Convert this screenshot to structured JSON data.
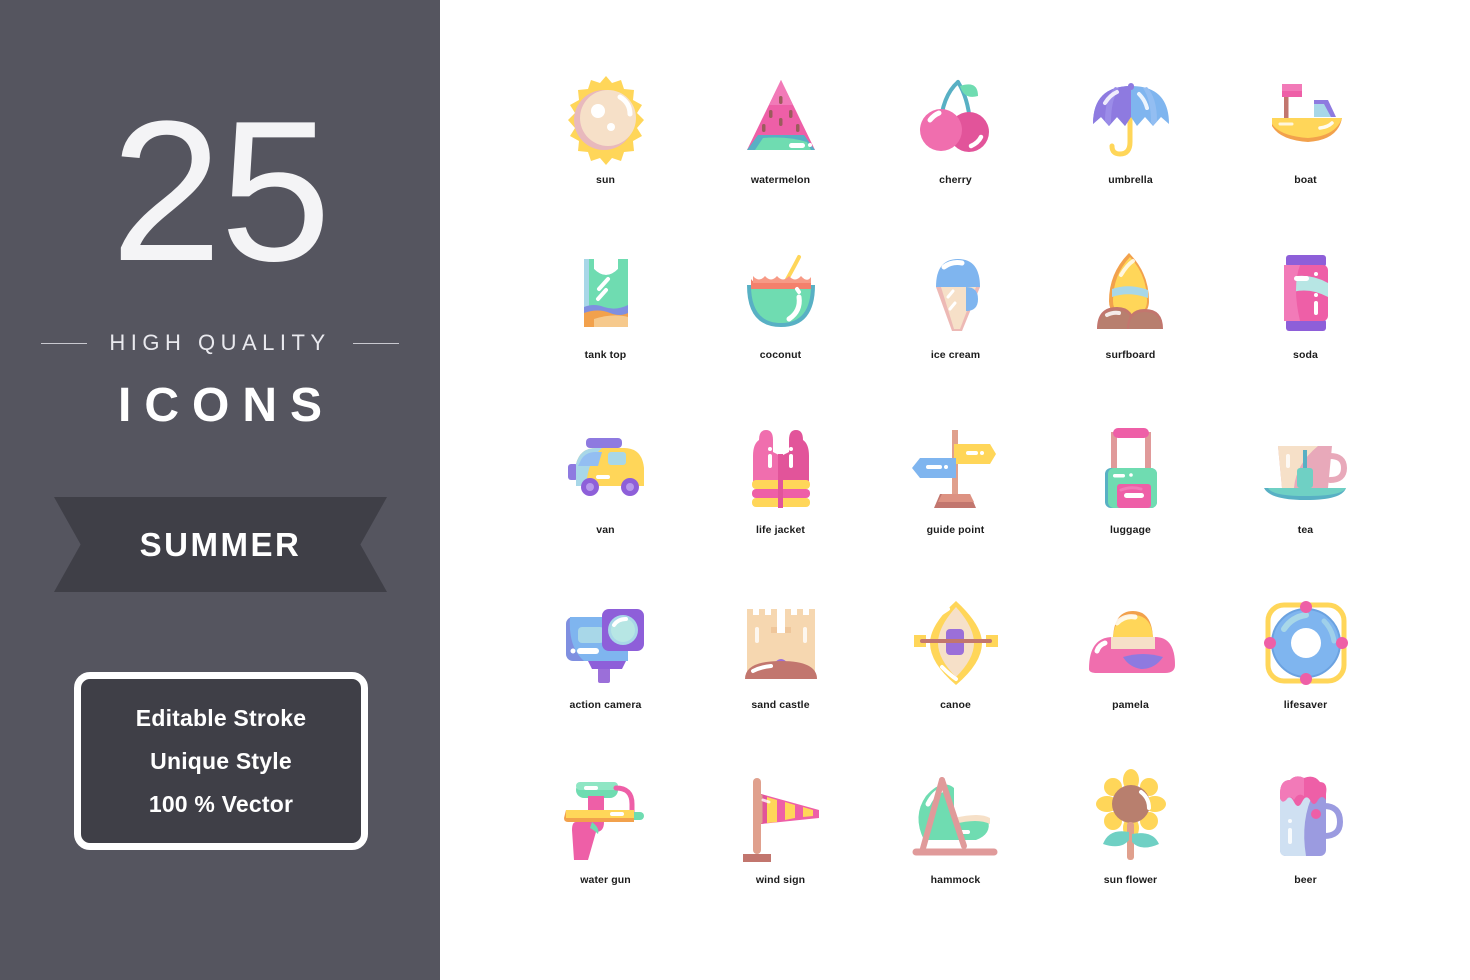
{
  "sidebar": {
    "count": "25",
    "tagline": "HIGH QUALITY",
    "heading": "ICONS",
    "ribbon_label": "SUMMER",
    "features": [
      "Editable Stroke",
      "Unique Style",
      "100 % Vector"
    ],
    "colors": {
      "background": "#55555f",
      "panel": "#3f3f47",
      "text": "#ffffff",
      "number": "#f4f4f6"
    }
  },
  "grid": {
    "columns": 5,
    "rows": 5,
    "total": 25,
    "background": "#ffffff",
    "label_color": "#1c1c1c",
    "icons": [
      {
        "id": "sun",
        "label": "sun",
        "icon_name": "sun-icon",
        "colors": [
          "#ffd659",
          "#efc0bf",
          "#f6e0c8"
        ]
      },
      {
        "id": "watermelon",
        "label": "watermelon",
        "icon_name": "watermelon-icon",
        "colors": [
          "#ee5fa7",
          "#6bd3b5",
          "#58b0c4"
        ]
      },
      {
        "id": "cherry",
        "label": "cherry",
        "icon_name": "cherry-icon",
        "colors": [
          "#f06eae",
          "#6bd3b5",
          "#58b0c4"
        ]
      },
      {
        "id": "umbrella",
        "label": "umbrella",
        "icon_name": "umbrella-icon",
        "colors": [
          "#8e7ae0",
          "#7fb5ef",
          "#ffd659"
        ]
      },
      {
        "id": "boat",
        "label": "boat",
        "icon_name": "boat-icon",
        "colors": [
          "#ffd659",
          "#f2a14c",
          "#ee5fa7"
        ]
      },
      {
        "id": "tank-top",
        "label": "tank top",
        "icon_name": "tank-top-icon",
        "colors": [
          "#6fdcb1",
          "#7f8fe0",
          "#f2a14c"
        ]
      },
      {
        "id": "coconut",
        "label": "coconut",
        "icon_name": "coconut-icon",
        "colors": [
          "#6fdcb1",
          "#f4806c",
          "#ffd659"
        ]
      },
      {
        "id": "ice-cream",
        "label": "ice cream",
        "icon_name": "ice-cream-icon",
        "colors": [
          "#7fb5ef",
          "#edb9b5",
          "#f6e0c8"
        ]
      },
      {
        "id": "surfboard",
        "label": "surfboard",
        "icon_name": "surfboard-icon",
        "colors": [
          "#ffd659",
          "#a8d7e8",
          "#b87f6e"
        ]
      },
      {
        "id": "soda",
        "label": "soda",
        "icon_name": "soda-can-icon",
        "colors": [
          "#ee5fa7",
          "#8e5fd9",
          "#b7e6e4"
        ]
      },
      {
        "id": "van",
        "label": "van",
        "icon_name": "van-icon",
        "colors": [
          "#ffd659",
          "#8e7ae0",
          "#a8d7e8"
        ]
      },
      {
        "id": "life-jacket",
        "label": "life jacket",
        "icon_name": "life-jacket-icon",
        "colors": [
          "#f06eae",
          "#ffd659",
          "#e2549a"
        ]
      },
      {
        "id": "guide-point",
        "label": "guide point",
        "icon_name": "guide-point-icon",
        "colors": [
          "#7fb5ef",
          "#ffd659",
          "#c2766e"
        ]
      },
      {
        "id": "luggage",
        "label": "luggage",
        "icon_name": "luggage-icon",
        "colors": [
          "#6fdcb1",
          "#ee5fa7",
          "#e09a9a"
        ]
      },
      {
        "id": "tea",
        "label": "tea",
        "icon_name": "tea-cup-icon",
        "colors": [
          "#f6e0c8",
          "#e8a9ba",
          "#6fd0c4"
        ]
      },
      {
        "id": "action-camera",
        "label": "action camera",
        "icon_name": "action-camera-icon",
        "colors": [
          "#7f8fe0",
          "#7fb5ef",
          "#9b6fd9"
        ]
      },
      {
        "id": "sand-castle",
        "label": "sand castle",
        "icon_name": "sand-castle-icon",
        "colors": [
          "#f6d7b0",
          "#c2766e",
          "#9b6fd9"
        ]
      },
      {
        "id": "canoe",
        "label": "canoe",
        "icon_name": "canoe-icon",
        "colors": [
          "#ffd659",
          "#9b6fd9",
          "#f6e0c8"
        ]
      },
      {
        "id": "pamela",
        "label": "pamela",
        "icon_name": "pamela-hat-icon",
        "colors": [
          "#f06eae",
          "#ffd659",
          "#8e7ae0"
        ]
      },
      {
        "id": "lifesaver",
        "label": "lifesaver",
        "icon_name": "lifesaver-icon",
        "colors": [
          "#7fb5ef",
          "#ffd659",
          "#ee5fa7"
        ]
      },
      {
        "id": "water-gun",
        "label": "water gun",
        "icon_name": "water-gun-icon",
        "colors": [
          "#ffd659",
          "#ee5fa7",
          "#6fdcb1"
        ]
      },
      {
        "id": "wind-sign",
        "label": "wind sign",
        "icon_name": "wind-sign-icon",
        "colors": [
          "#ee5fa7",
          "#ffd659",
          "#e0a08d"
        ]
      },
      {
        "id": "hammock",
        "label": "hammock",
        "icon_name": "hammock-icon",
        "colors": [
          "#6fdcb1",
          "#e09a9a",
          "#f6e0c8"
        ]
      },
      {
        "id": "sun-flower",
        "label": "sun flower",
        "icon_name": "sun-flower-icon",
        "colors": [
          "#ffd659",
          "#b87f6e",
          "#6fd0c4"
        ]
      },
      {
        "id": "beer",
        "label": "beer",
        "icon_name": "beer-mug-icon",
        "colors": [
          "#cfe0f2",
          "#ee5fa7",
          "#9b9be0"
        ]
      }
    ]
  }
}
